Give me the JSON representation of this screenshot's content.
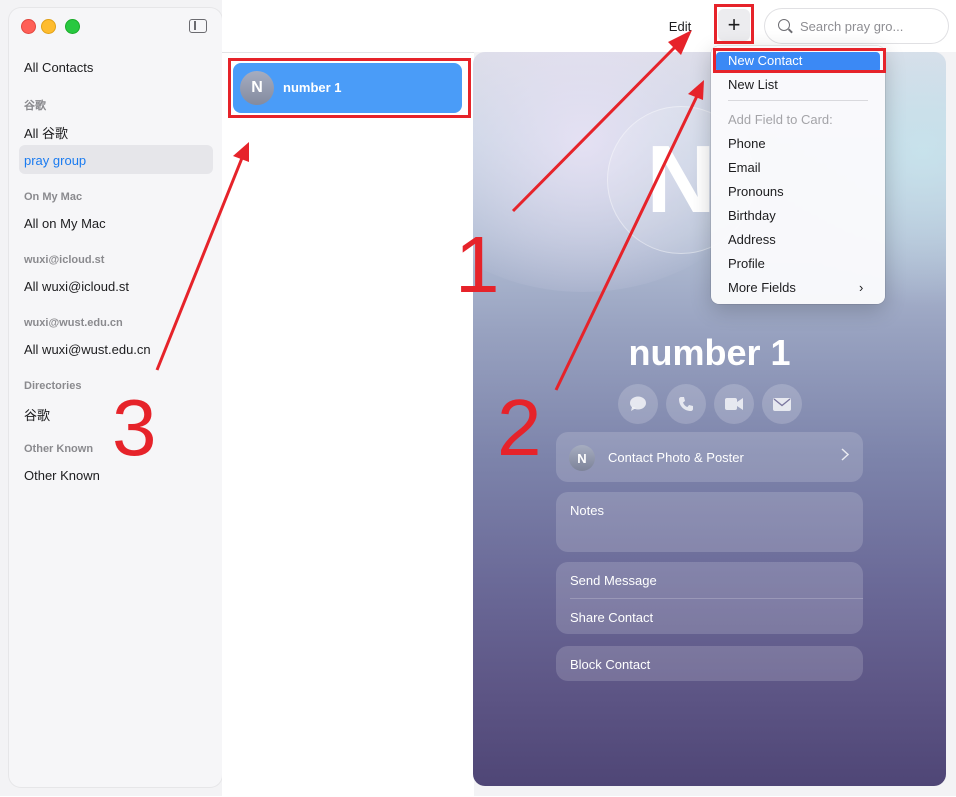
{
  "sidebar": {
    "groups": [
      {
        "heading": "",
        "items": [
          "All Contacts"
        ]
      },
      {
        "heading": "谷歌",
        "items": [
          "All 谷歌",
          "pray group"
        ]
      },
      {
        "heading": "On My Mac",
        "items": [
          "All on My Mac"
        ]
      },
      {
        "heading": "wuxi@icloud.st",
        "items": [
          "All wuxi@icloud.st"
        ]
      },
      {
        "heading": "wuxi@wust.edu.cn",
        "items": [
          "All wuxi@wust.edu.cn"
        ]
      },
      {
        "heading": "Directories",
        "items": [
          "谷歌"
        ]
      },
      {
        "heading": "Other Known",
        "items": [
          "Other Known"
        ]
      }
    ],
    "selected": "pray group",
    "selected_color": "#1a7bf0"
  },
  "toolbar": {
    "edit_label": "Edit",
    "add_label": "+",
    "search_placeholder": "Search pray gro..."
  },
  "list": {
    "items": [
      {
        "initial": "N",
        "name": "number 1"
      }
    ]
  },
  "card": {
    "initial": "N",
    "name": "number 1",
    "actions": [
      "message-icon",
      "phone-icon",
      "video-icon",
      "mail-icon"
    ],
    "photo_poster": {
      "initial": "N",
      "label": "Contact Photo & Poster"
    },
    "notes_label": "Notes",
    "send_message": "Send Message",
    "share_contact": "Share Contact",
    "block_contact": "Block Contact"
  },
  "menu": {
    "items": [
      "New Contact",
      "New List"
    ],
    "field_heading": "Add Field to Card:",
    "fields": [
      "Phone",
      "Email",
      "Pronouns",
      "Birthday",
      "Address",
      "Profile",
      "More Fields"
    ],
    "highlighted": "New Contact",
    "more_arrow": "›"
  },
  "annotations": {
    "labels": [
      "1",
      "2",
      "3"
    ],
    "color": "#e6232a"
  }
}
